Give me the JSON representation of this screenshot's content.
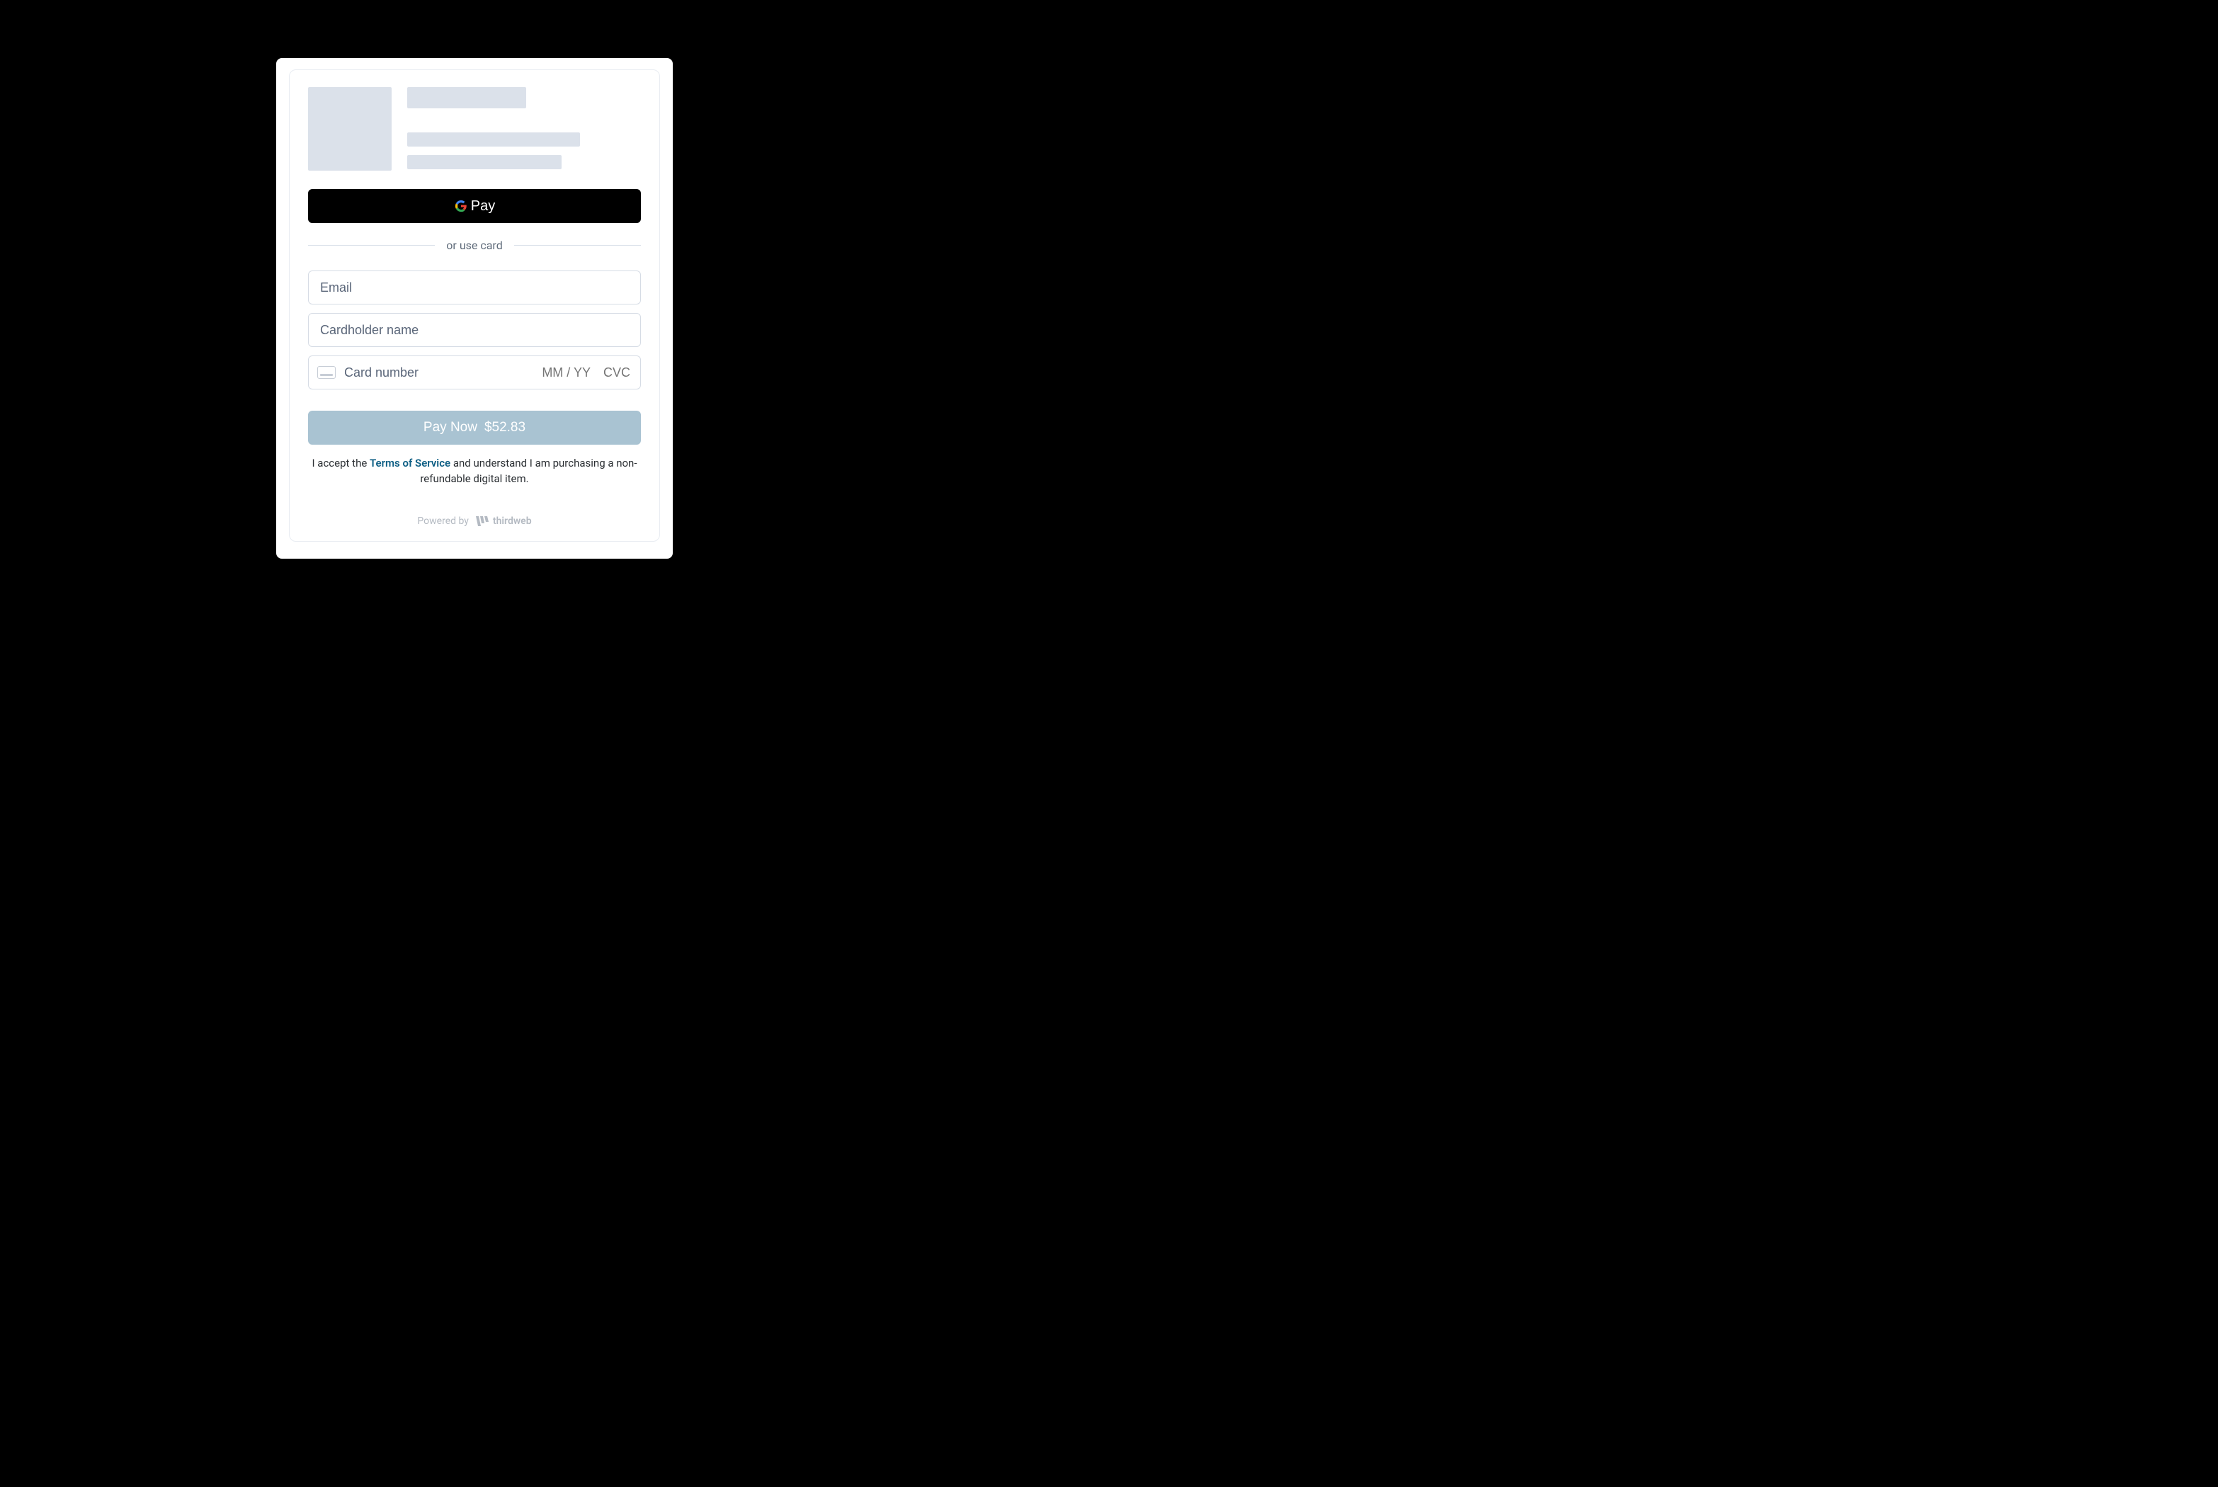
{
  "gpay": {
    "label": "Pay"
  },
  "divider": {
    "label": "or use card"
  },
  "form": {
    "email_placeholder": "Email",
    "cardholder_placeholder": "Cardholder name",
    "cardnumber_placeholder": "Card number",
    "expiry_placeholder": "MM / YY",
    "cvc_placeholder": "CVC"
  },
  "pay": {
    "label": "Pay Now",
    "amount": "$52.83"
  },
  "disclaimer": {
    "prefix": "I accept the ",
    "tos": "Terms of Service",
    "suffix": " and understand I am purchasing a non-refundable digital item."
  },
  "footer": {
    "powered_by": "Powered by",
    "brand": "thirdweb"
  }
}
